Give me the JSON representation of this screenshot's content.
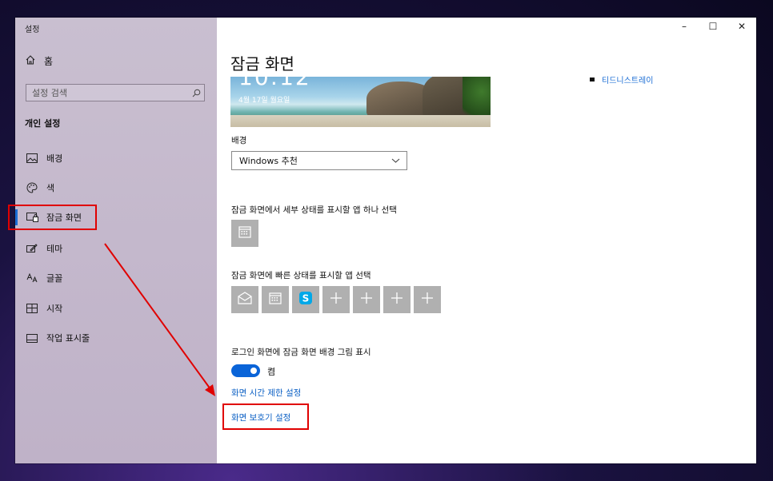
{
  "window": {
    "title": "설정",
    "controls": {
      "minimize": "–",
      "maximize": "☐",
      "close": "✕"
    }
  },
  "sidebar": {
    "home_label": "홈",
    "search_placeholder": "설정 검색",
    "section_title": "개인 설정",
    "items": [
      {
        "label": "배경",
        "icon": "image-icon"
      },
      {
        "label": "색",
        "icon": "palette-icon"
      },
      {
        "label": "잠금 화면",
        "icon": "lock-screen-icon",
        "active": true
      },
      {
        "label": "테마",
        "icon": "theme-icon"
      },
      {
        "label": "글꼴",
        "icon": "font-icon"
      },
      {
        "label": "시작",
        "icon": "start-icon"
      },
      {
        "label": "작업 표시줄",
        "icon": "taskbar-icon"
      }
    ]
  },
  "main": {
    "page_title": "잠금 화면",
    "preview": {
      "clock": "10:12",
      "date": "4월 17일 월요일"
    },
    "top_right_hint": "티드니스트레이",
    "background_label": "배경",
    "background_value": "Windows 추천",
    "detail_status_label": "잠금 화면에서 세부 상태를 표시할 앱 하나 선택",
    "quick_status_label": "잠금 화면에 빠른 상태를 표시할 앱 선택",
    "quick_tiles": [
      "mail-icon",
      "calendar-icon",
      "skype-icon",
      "plus-icon",
      "plus-icon",
      "plus-icon",
      "plus-icon"
    ],
    "show_bg_label": "로그인 화면에 잠금 화면 배경 그림 표시",
    "toggle_state": "켬",
    "link_timeout": "화면 시간 제한 설정",
    "link_screensaver": "화면 보호기 설정"
  },
  "colors": {
    "accent": "#0a64d8",
    "link": "#0a5fc4",
    "highlight": "#e00000",
    "sidebar_bg": "#c4b8cc"
  }
}
